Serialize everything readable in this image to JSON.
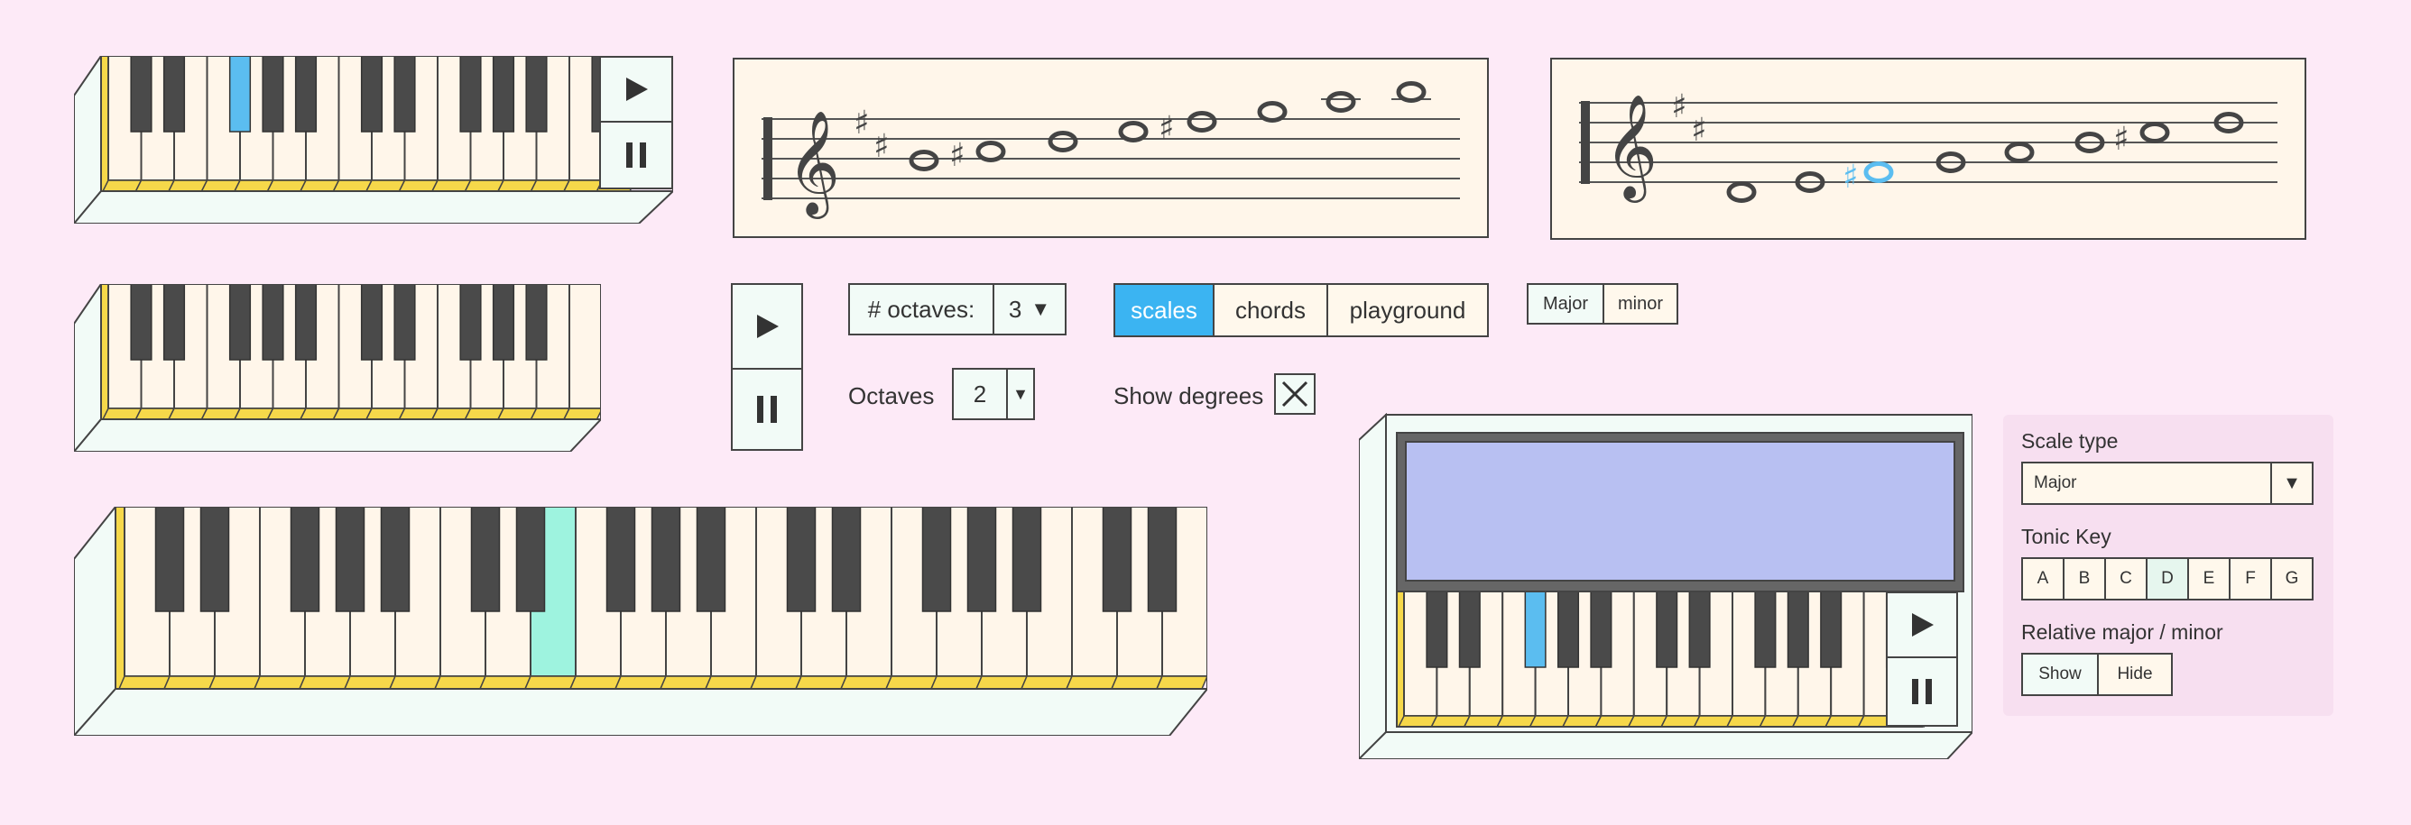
{
  "colors": {
    "background": "#fdeaf7",
    "key_white": "#fff6ea",
    "key_black": "#4a4a4a",
    "highlight_blue": "#5bbdf0",
    "highlight_mint": "#9ef3df",
    "accent_yellow": "#f6d84a",
    "segment_selected": "#3bb4f2",
    "screen": "#b8c0f2"
  },
  "transport": {
    "play_icon": "play-icon",
    "pause_icon": "pause-icon"
  },
  "octaves_picker": {
    "label": "# octaves:",
    "value": "3",
    "arrow": "▼"
  },
  "octaves_small": {
    "label": "Octaves",
    "value": "2",
    "arrow": "▼"
  },
  "modes": [
    {
      "label": "scales",
      "selected": true
    },
    {
      "label": "chords",
      "selected": false
    },
    {
      "label": "playground",
      "selected": false
    }
  ],
  "quality_toggle": [
    {
      "label": "Major",
      "selected": true
    },
    {
      "label": "minor",
      "selected": false
    }
  ],
  "show_degrees": {
    "label": "Show degrees",
    "checked": true,
    "icon": "close-x-icon"
  },
  "side_panel": {
    "scale_type_label": "Scale type",
    "scale_type_value": "Major",
    "scale_type_arrow": "▼",
    "tonic_label": "Tonic Key",
    "tonic_keys": [
      "A",
      "B",
      "C",
      "D",
      "E",
      "F",
      "G"
    ],
    "tonic_selected": "D",
    "relative_label": "Relative major / minor",
    "relative_options": [
      "Show",
      "Hide"
    ],
    "relative_selected": "Show"
  },
  "staff_glyphs": {
    "treble": "𝄞",
    "sharp": "♯",
    "whole_note": "𝅝"
  }
}
